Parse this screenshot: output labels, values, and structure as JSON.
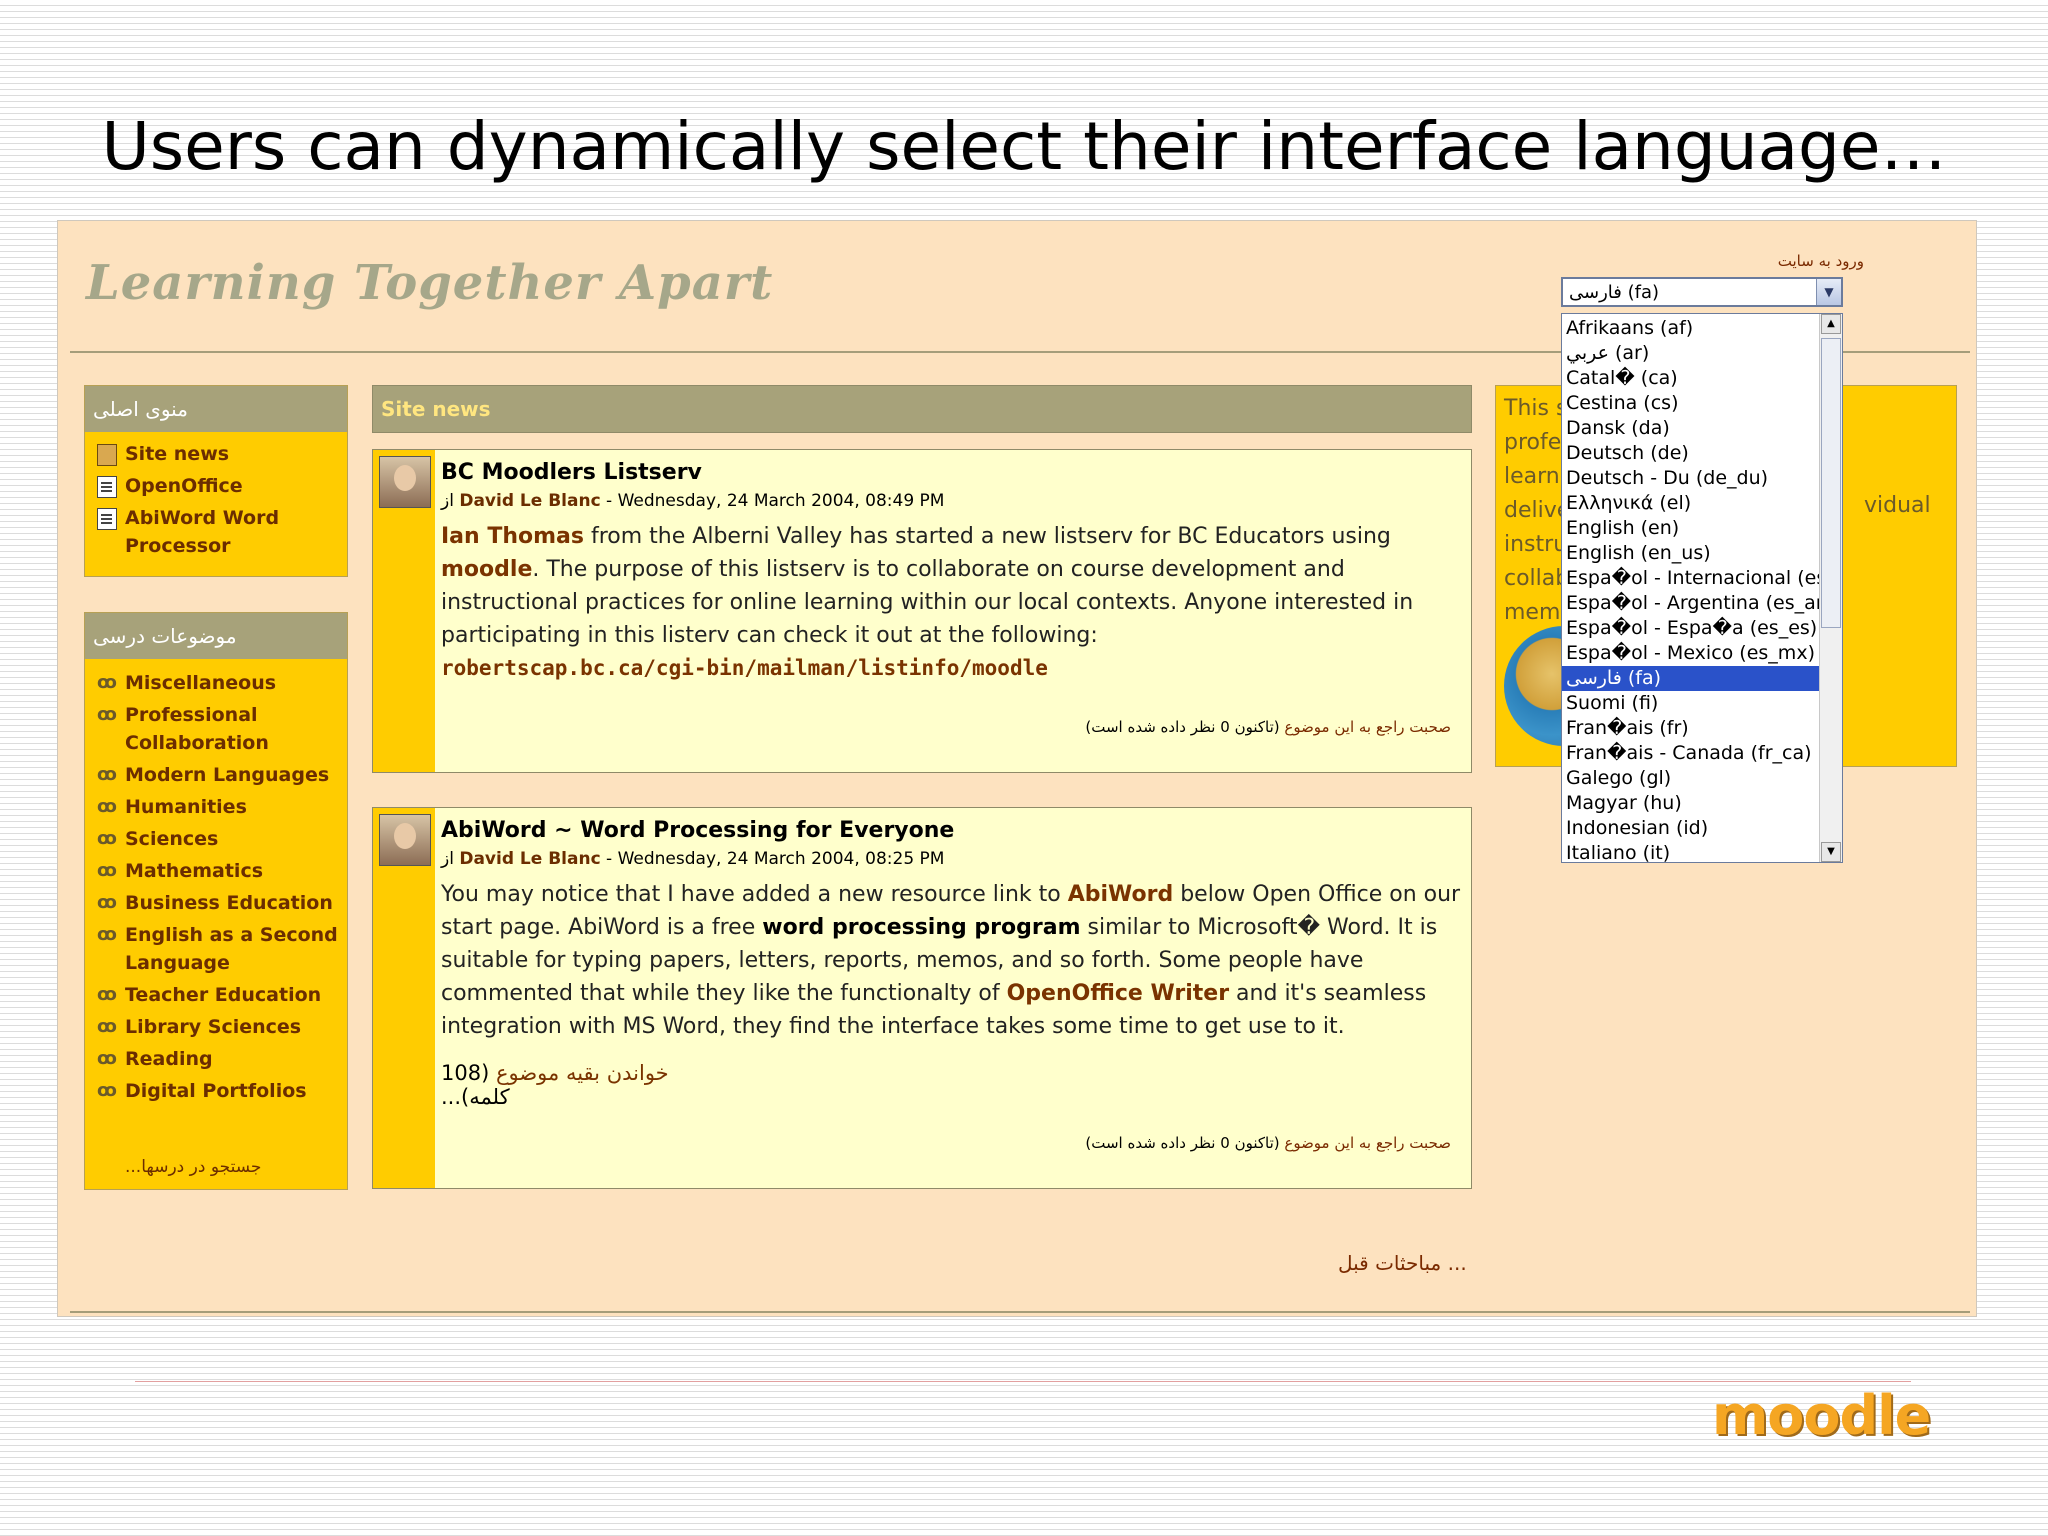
{
  "slide": {
    "title": "Users can dynamically select their interface language…",
    "logo": "moodle"
  },
  "site": {
    "title": "Learning Together Apart",
    "login_link": "ورود به سایت",
    "language_selected": "فارسی (fa)",
    "language_options": [
      "Afrikaans (af)",
      "عربي (ar)",
      "Catal� (ca)",
      "Cestina (cs)",
      "Dansk (da)",
      "Deutsch (de)",
      "Deutsch - Du (de_du)",
      "Ελληνικά (el)",
      "English (en)",
      "English (en_us)",
      "Espa�ol - Internacional (es)",
      "Espa�ol - Argentina (es_ar)",
      "Espa�ol - Espa�a (es_es)",
      "Espa�ol - Mexico (es_mx)",
      "فارسی (fa)",
      "Suomi (fi)",
      "Fran�ais (fr)",
      "Fran�ais - Canada (fr_ca)",
      "Galego (gl)",
      "Magyar (hu)",
      "Indonesian (id)",
      "Italiano (it)"
    ]
  },
  "main_menu": {
    "title": "منوی اصلی",
    "items": [
      "Site news",
      "OpenOffice",
      "AbiWord Word Processor"
    ]
  },
  "courses": {
    "title": "موضوعات درسی",
    "items": [
      "Miscellaneous",
      "Professional Collaboration",
      "Modern Languages",
      "Humanities",
      "Sciences",
      "Mathematics",
      "Business Education",
      "English as a Second Language",
      "Teacher Education",
      "Library Sciences",
      "Reading",
      "Digital Portfolios"
    ],
    "search": "جستجو در درسها..."
  },
  "news": {
    "header": "Site news",
    "posts": [
      {
        "subject": "BC Moodlers Listserv",
        "by": "از",
        "author": "David Le Blanc",
        "date": " - Wednesday, 24 March 2004, 08:49 PM",
        "name_start": "Ian Thomas",
        "text_a": " from the Alberni Valley has started a new listserv for BC Educators using ",
        "moodle": "moodle",
        "text_b": ". The purpose of this listserv is to collaborate on course development and instructional practices for online learning within our local contexts. Anyone interested in participating in this listerv can check it out at the following:",
        "url": "robertscap.bc.ca/cgi-bin/mailman/listinfo/moodle",
        "discuss_link": "صحبت راجع به این موضوع",
        "discuss_count": " (تاکنون 0 نظر داده شده است)"
      },
      {
        "subject": "AbiWord ~ Word Processing for Everyone",
        "by": "از",
        "author": "David Le Blanc",
        "date": " - Wednesday, 24 March 2004, 08:25 PM",
        "t1": "You may notice that I have added a new resource link to ",
        "abiword": "AbiWord",
        "t2": " below Open Office on our start page. AbiWord is a free ",
        "wpp": "word processing program",
        "t3": " similar to Microsoft� Word. It is suitable for typing papers, letters, reports, memos, and so forth. Some people have commented that while they like the functionalty of ",
        "oow": "OpenOffice Writer",
        "t4": " and it's seamless integration with MS Word, they find the interface takes some time to get use to it.",
        "read_more": "خواندن بقیه موضوع",
        "read_more_count": " (108 کلمه)...",
        "discuss_link": "صحبت راجع به این موضوع",
        "discuss_count": " (تاکنون 0 نظر داده شده است)"
      }
    ],
    "older": "... مباحثات قبل"
  },
  "right_block": {
    "lines": [
      "This s",
      "profe",
      "learne",
      "delive",
      "instru",
      "collab",
      "memb"
    ],
    "fragment": "vidual"
  }
}
